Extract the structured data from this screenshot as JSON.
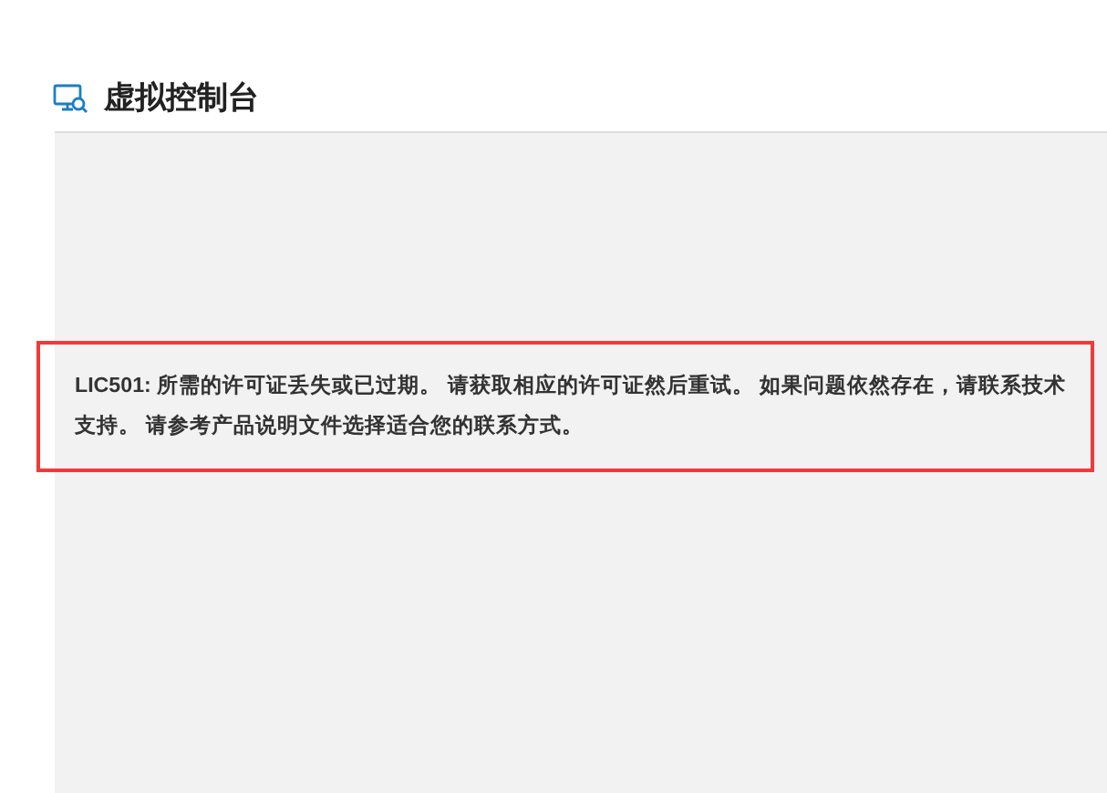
{
  "header": {
    "title": "虚拟控制台"
  },
  "message": {
    "text": "LIC501: 所需的许可证丢失或已过期。 请获取相应的许可证然后重试。 如果问题依然存在，请联系技术支持。 请参考产品说明文件选择适合您的联系方式。",
    "highlighted": true
  }
}
